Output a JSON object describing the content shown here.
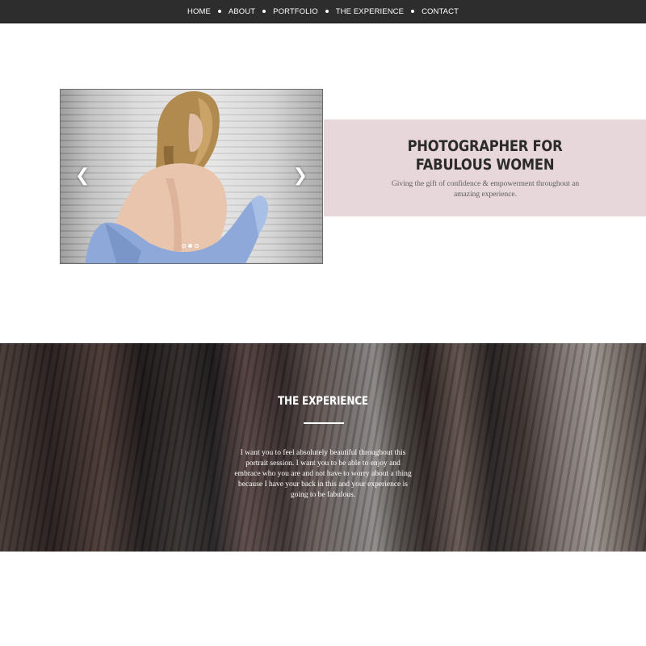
{
  "nav": {
    "items": [
      {
        "label": "HOME"
      },
      {
        "label": "ABOUT"
      },
      {
        "label": "PORTFOLIO"
      },
      {
        "label": "THE EXPERIENCE"
      },
      {
        "label": "CONTACT"
      }
    ]
  },
  "hero": {
    "slider": {
      "prev_icon": "chevron-left-icon",
      "next_icon": "chevron-right-icon",
      "slide_count": 3,
      "active_slide": 2
    },
    "title": "PHOTOGRAPHER FOR\nFABULOUS WOMEN",
    "subtitle": "Giving the gift of confidence & empowerment throughout an amazing experience."
  },
  "experience": {
    "title": "THE EXPERIENCE",
    "body": "I want you to feel absolutely beautiful throughout this portrait session. I want you to be able to enjoy and embrace who you are and not have to worry about a thing because I have your back in this and your experience is going to be fabulous."
  },
  "colors": {
    "nav_bg": "#2d2d2d",
    "intro_bg": "#e7d7da",
    "title_text": "#2b2b2b"
  }
}
